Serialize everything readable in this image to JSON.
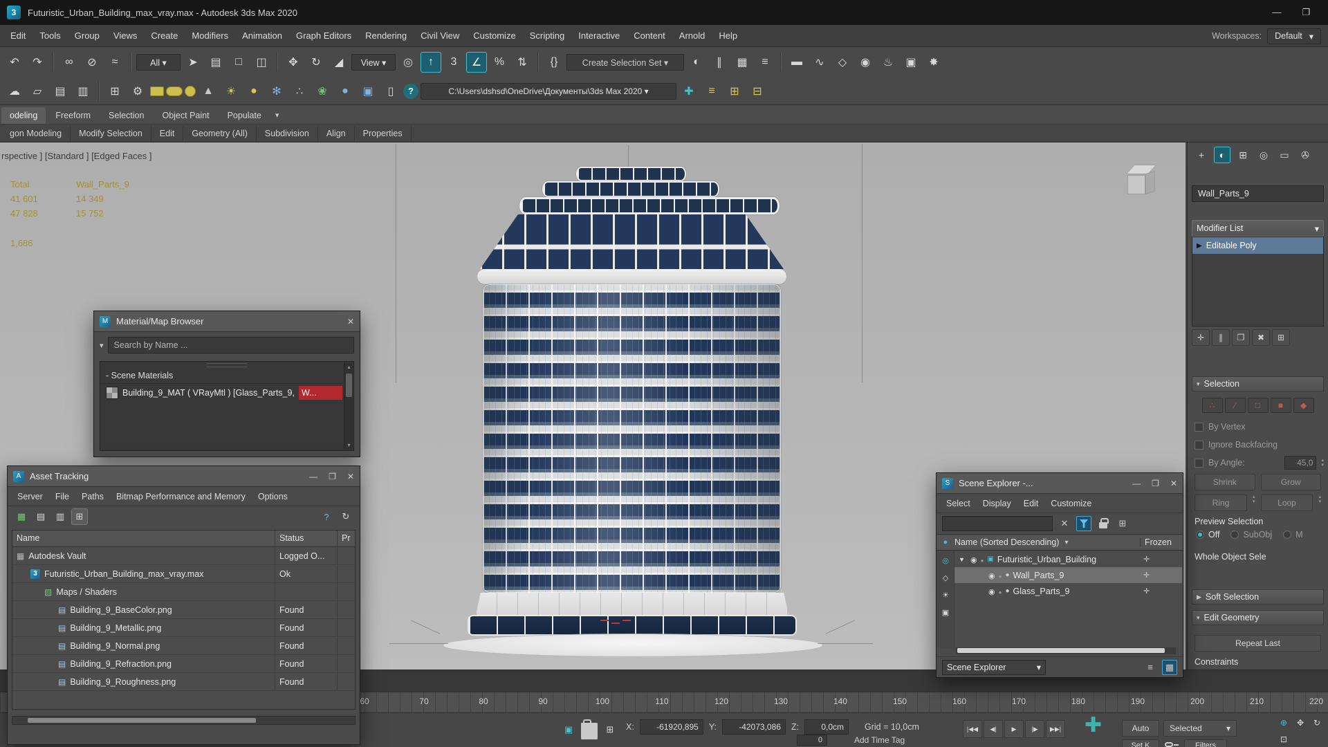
{
  "window": {
    "title": "Futuristic_Urban_Building_max_vray.max - Autodesk 3ds Max 2020",
    "logo_glyph": "3"
  },
  "icons": {
    "minimize": "—",
    "maximize": "❐",
    "close": "✕",
    "caret_down": "▾",
    "caret_right": "▶",
    "caret_up": "▴",
    "search_caret": "▾"
  },
  "menubar": {
    "items": [
      "Edit",
      "Tools",
      "Group",
      "Views",
      "Create",
      "Modifiers",
      "Animation",
      "Graph Editors",
      "Rendering",
      "Civil View",
      "Customize",
      "Scripting",
      "Interactive",
      "Content",
      "Arnold",
      "Help"
    ],
    "workspaces_label": "Workspaces:",
    "workspaces_value": "Default"
  },
  "toolbar1": {
    "items": [
      {
        "name": "undo-icon",
        "glyph": "↶",
        "inter": "true"
      },
      {
        "name": "redo-icon",
        "glyph": "↷",
        "inter": "true"
      },
      {
        "name": "divider",
        "cls": "tdiv",
        "glyph": "",
        "inter": "false"
      },
      {
        "name": "select-and-link-icon",
        "glyph": "∞",
        "inter": "true"
      },
      {
        "name": "unlink-selection-icon",
        "glyph": "⊘",
        "inter": "true"
      },
      {
        "name": "bind-to-space-warp-icon",
        "glyph": "≈",
        "inter": "true"
      },
      {
        "name": "divider",
        "cls": "tdiv",
        "glyph": "",
        "inter": "false"
      },
      {
        "name": "selection-filter-dropdown",
        "glyph": "All ▾",
        "cls": "dd",
        "inter": "true"
      },
      {
        "name": "select-object-icon",
        "glyph": "➤",
        "inter": "true"
      },
      {
        "name": "select-by-name-icon",
        "glyph": "▤",
        "inter": "true"
      },
      {
        "name": "rectangular-selection-region-icon",
        "glyph": "□",
        "inter": "true"
      },
      {
        "name": "window-crossing-toggle-icon",
        "glyph": "◫",
        "inter": "true"
      },
      {
        "name": "divider",
        "cls": "tdiv",
        "glyph": "",
        "inter": "false"
      },
      {
        "name": "select-and-move-icon",
        "glyph": "✥",
        "inter": "true"
      },
      {
        "name": "select-and-rotate-icon",
        "glyph": "↻",
        "inter": "true"
      },
      {
        "name": "select-and-scale-icon",
        "glyph": "◢",
        "inter": "true"
      },
      {
        "name": "reference-coordinate-dropdown",
        "glyph": "View ▾",
        "cls": "dd",
        "inter": "true"
      },
      {
        "name": "use-pivot-point-center-icon",
        "glyph": "◎",
        "inter": "true"
      },
      {
        "name": "select-and-place-icon",
        "glyph": "↑",
        "cls": "active",
        "inter": "true"
      },
      {
        "name": "snaps-toggle-icon",
        "glyph": "3",
        "inter": "true"
      },
      {
        "name": "angle-snap-toggle-icon",
        "glyph": "∠",
        "cls": "active",
        "inter": "true"
      },
      {
        "name": "percent-snap-toggle-icon",
        "glyph": "%",
        "inter": "true"
      },
      {
        "name": "spinner-snap-toggle-icon",
        "glyph": "⇅",
        "inter": "true"
      },
      {
        "name": "divider",
        "cls": "tdiv",
        "glyph": "",
        "inter": "false"
      },
      {
        "name": "edit-named-selection-sets-icon",
        "glyph": "{}",
        "inter": "true"
      },
      {
        "name": "named-selection-set-dropdown",
        "glyph": "Create Selection Set ▾",
        "cls": "dd ddwide",
        "inter": "true"
      },
      {
        "name": "mirror-icon",
        "glyph": "◐",
        "inter": "true"
      },
      {
        "name": "align-icon",
        "glyph": "∥",
        "inter": "true"
      },
      {
        "name": "toggle-scene-explorer-icon",
        "glyph": "▦",
        "inter": "true"
      },
      {
        "name": "toggle-layer-explorer-icon",
        "glyph": "≡",
        "inter": "true"
      },
      {
        "name": "divider",
        "cls": "tdiv",
        "glyph": "",
        "inter": "false"
      },
      {
        "name": "toggle-ribbon-icon",
        "glyph": "▬",
        "inter": "true"
      },
      {
        "name": "curve-editor-icon",
        "glyph": "∿",
        "inter": "true"
      },
      {
        "name": "schematic-view-icon",
        "glyph": "◇",
        "inter": "true"
      },
      {
        "name": "material-editor-icon",
        "glyph": "◉",
        "inter": "true"
      },
      {
        "name": "render-setup-icon",
        "glyph": "♨",
        "inter": "true"
      },
      {
        "name": "rendered-frame-window-icon",
        "glyph": "▣",
        "inter": "true"
      },
      {
        "name": "render-production-icon",
        "glyph": "✸",
        "inter": "true"
      }
    ]
  },
  "toolbar2": {
    "items": [
      {
        "name": "autoback-cloud-icon",
        "glyph": "☁",
        "inter": "true"
      },
      {
        "name": "new-scene-icon",
        "glyph": "▱",
        "inter": "true"
      },
      {
        "name": "open-file-icon",
        "glyph": "▤",
        "inter": "true"
      },
      {
        "name": "save-file-icon",
        "glyph": "▥",
        "inter": "true"
      },
      {
        "name": "divider",
        "cls": "tdiv",
        "glyph": "",
        "inter": "false"
      },
      {
        "name": "grid-helper-icon",
        "glyph": "⊞",
        "inter": "true"
      },
      {
        "name": "gear-icon",
        "glyph": "⚙",
        "inter": "true"
      },
      {
        "name": "swatch-square-icon",
        "glyph": "",
        "cls": "sw",
        "inter": "true"
      },
      {
        "name": "swatch-pill-icon",
        "glyph": "",
        "cls": "sw sw-pill",
        "inter": "true"
      },
      {
        "name": "swatch-circle-icon",
        "glyph": "",
        "cls": "sw sw-circle",
        "inter": "true"
      },
      {
        "name": "cone-primitive-icon",
        "glyph": "▲",
        "cls": "c-gray",
        "inter": "true"
      },
      {
        "name": "sunlight-icon",
        "glyph": "☀",
        "cls": "c-yellow",
        "inter": "true"
      },
      {
        "name": "sphere-primitive-icon",
        "glyph": "●",
        "cls": "c-yellow",
        "inter": "true"
      },
      {
        "name": "snowflake-icon",
        "glyph": "✻",
        "cls": "c-blue",
        "inter": "true"
      },
      {
        "name": "scatter-icon",
        "glyph": "∴",
        "cls": "c-gray",
        "inter": "true"
      },
      {
        "name": "foliage-icon",
        "glyph": "❀",
        "cls": "c-green",
        "inter": "true"
      },
      {
        "name": "physical-sphere-icon",
        "glyph": "●",
        "cls": "c-blue",
        "inter": "true"
      },
      {
        "name": "compositor-icon",
        "glyph": "▣",
        "cls": "c-blue",
        "inter": "true"
      },
      {
        "name": "state-sets-icon",
        "glyph": "▯",
        "inter": "true"
      },
      {
        "name": "help-icon",
        "glyph": "?",
        "cls": "help",
        "inter": "true"
      },
      {
        "name": "project-folder-dropdown",
        "glyph": "C:\\Users\\dshsd\\OneDrive\\Документы\\3ds Max 2020  ▾",
        "cls": "dd path",
        "inter": "true"
      },
      {
        "name": "create-new-folder-icon",
        "glyph": "✚",
        "cls": "c-teal",
        "inter": "true"
      },
      {
        "name": "layer-list-icon",
        "glyph": "≡",
        "cls": "c-yellow",
        "inter": "true"
      },
      {
        "name": "add-grid-icon",
        "glyph": "⊞",
        "cls": "c-yellow",
        "inter": "true"
      },
      {
        "name": "remove-grid-icon",
        "glyph": "⊟",
        "cls": "c-yellow",
        "inter": "true"
      }
    ]
  },
  "ribbon": {
    "tabs": [
      {
        "label": "odeling",
        "cls": "active",
        "inter": "true"
      },
      {
        "label": "Freeform",
        "inter": "true"
      },
      {
        "label": "Selection",
        "inter": "true"
      },
      {
        "label": "Object Paint",
        "inter": "true"
      },
      {
        "label": "Populate",
        "inter": "true"
      }
    ],
    "panels": [
      "gon Modeling",
      "Modify Selection",
      "Edit",
      "Geometry (All)",
      "Subdivision",
      "Align",
      "Properties"
    ]
  },
  "viewport": {
    "label": "rspective ] [Standard ] [Edged Faces ]",
    "stats": {
      "col1": "Total",
      "col2": "Wall_Parts_9",
      "r1c1": "41 601",
      "r1c2": "14 349",
      "r2c1": "47 828",
      "r2c2": "15 752",
      "extra": "1,686"
    }
  },
  "material_browser": {
    "title": "Material/Map Browser",
    "search_placeholder": "Search by Name ...",
    "section": "- Scene Materials",
    "material_main": "Building_9_MAT   ( VRayMtl )  [Glass_Parts_9, ",
    "material_tail": "W..."
  },
  "asset_tracking": {
    "title": "Asset Tracking",
    "menus": [
      "Server",
      "File",
      "Paths",
      "Bitmap Performance and Memory",
      "Options"
    ],
    "toolbar": [
      {
        "name": "table-view-icon",
        "glyph": "▦",
        "cls": "c-green",
        "inter": "true"
      },
      {
        "name": "list-view-icon",
        "glyph": "▤",
        "inter": "true"
      },
      {
        "name": "details-view-icon",
        "glyph": "▥",
        "inter": "true"
      },
      {
        "name": "grid-view-icon",
        "glyph": "⊞",
        "cls": "pressed",
        "inter": "true"
      },
      {
        "name": "spacer",
        "cls": "sp",
        "glyph": "",
        "inter": "false"
      },
      {
        "name": "help-icon",
        "glyph": "?",
        "cls": "c-blue",
        "inter": "true"
      },
      {
        "name": "refresh-icon",
        "glyph": "↻",
        "inter": "true"
      }
    ],
    "columns": {
      "name": "Name",
      "status": "Status",
      "progress": "Pr"
    },
    "rows": [
      {
        "label": "Autodesk Vault",
        "status": "Logged O...",
        "cls": "lvl0",
        "icon": "ic-vault",
        "iname": "vault-icon",
        "iglyph": "▦"
      },
      {
        "label": "Futuristic_Urban_Building_max_vray.max",
        "status": "Ok",
        "cls": "lvl1",
        "icon": "ic-max",
        "iname": "max-file-icon",
        "iglyph": "3"
      },
      {
        "label": "Maps / Shaders",
        "status": "",
        "cls": "lvl2",
        "icon": "ic-maps",
        "iname": "maps-folder-icon",
        "iglyph": "▧"
      },
      {
        "label": "Building_9_BaseColor.png",
        "status": "Found",
        "cls": "lvl3",
        "icon": "ic-bmp",
        "iname": "bitmap-file-icon",
        "iglyph": "▤"
      },
      {
        "label": "Building_9_Metallic.png",
        "status": "Found",
        "cls": "lvl3",
        "icon": "ic-bmp",
        "iname": "bitmap-file-icon",
        "iglyph": "▤"
      },
      {
        "label": "Building_9_Normal.png",
        "status": "Found",
        "cls": "lvl3",
        "icon": "ic-bmp",
        "iname": "bitmap-file-icon",
        "iglyph": "▤"
      },
      {
        "label": "Building_9_Refraction.png",
        "status": "Found",
        "cls": "lvl3",
        "icon": "ic-bmp",
        "iname": "bitmap-file-icon",
        "iglyph": "▤"
      },
      {
        "label": "Building_9_Roughness.png",
        "status": "Found",
        "cls": "lvl3",
        "icon": "ic-bmp",
        "iname": "bitmap-file-icon",
        "iglyph": "▤"
      }
    ]
  },
  "scene_explorer": {
    "title": "Scene Explorer -...",
    "menus": [
      "Select",
      "Display",
      "Edit",
      "Customize"
    ],
    "header_name": "Name (Sorted Descending)",
    "header_frozen": "Frozen",
    "footer_value": "Scene Explorer",
    "filters": [
      {
        "name": "display-geometry-icon",
        "glyph": "◎",
        "cls": "c-teal",
        "inter": "true"
      },
      {
        "name": "display-shapes-icon",
        "glyph": "◇",
        "inter": "true"
      },
      {
        "name": "display-lights-icon",
        "glyph": "☀",
        "inter": "true"
      },
      {
        "name": "display-cameras-icon",
        "glyph": "▣",
        "inter": "true"
      }
    ],
    "rows": [
      {
        "label": "Futuristic_Urban_Building",
        "cls": "lvl0",
        "caret": "▼",
        "iname": "group-icon",
        "iglyph": "▣",
        "icls": "c-teal"
      },
      {
        "label": "Wall_Parts_9",
        "cls": "lvl1 selected",
        "caret": "",
        "iname": "geometry-icon",
        "iglyph": "●",
        "icls": "c-gray2"
      },
      {
        "label": "Glass_Parts_9",
        "cls": "lvl1",
        "caret": "",
        "iname": "geometry-icon",
        "iglyph": "●",
        "icls": "c-gray2"
      }
    ]
  },
  "command_panel": {
    "tabs": [
      {
        "name": "create-tab-icon",
        "glyph": "+",
        "inter": "true"
      },
      {
        "name": "modify-tab-icon",
        "glyph": "◐",
        "cls": "active",
        "inter": "true"
      },
      {
        "name": "hierarchy-tab-icon",
        "glyph": "⊞",
        "inter": "true"
      },
      {
        "name": "motion-tab-icon",
        "glyph": "◎",
        "inter": "true"
      },
      {
        "name": "display-tab-icon",
        "glyph": "▭",
        "inter": "true"
      },
      {
        "name": "utilities-tab-icon",
        "glyph": "✇",
        "inter": "true"
      }
    ],
    "object_name": "Wall_Parts_9",
    "modifier_list_label": "Modifier List",
    "stack_item": "Editable Poly",
    "stack_tools": [
      {
        "name": "pin-stack-icon",
        "glyph": "✛",
        "inter": "true"
      },
      {
        "name": "show-end-result-icon",
        "glyph": "∥",
        "inter": "true"
      },
      {
        "name": "make-unique-icon",
        "glyph": "❐",
        "inter": "true"
      },
      {
        "name": "remove-modifier-icon",
        "glyph": "✖",
        "inter": "true"
      },
      {
        "name": "configure-modifier-sets-icon",
        "glyph": "⊞",
        "inter": "true"
      }
    ],
    "selection": {
      "title": "Selection",
      "subobject": [
        {
          "name": "vertex-subobject-icon",
          "glyph": "∴",
          "inter": "true"
        },
        {
          "name": "edge-subobject-icon",
          "glyph": "∕",
          "inter": "true"
        },
        {
          "name": "border-subobject-icon",
          "glyph": "□",
          "inter": "true"
        },
        {
          "name": "polygon-subobject-icon",
          "glyph": "■",
          "inter": "true"
        },
        {
          "name": "element-subobject-icon",
          "glyph": "◆",
          "inter": "true"
        }
      ],
      "by_vertex": "By Vertex",
      "ignore_backfacing": "Ignore Backfacing",
      "by_angle": "By Angle:",
      "by_angle_value": "45,0",
      "shrink": "Shrink",
      "grow": "Grow",
      "ring": "Ring",
      "loop": "Loop",
      "preview_title": "Preview Selection",
      "opt_off": "Off",
      "opt_subobj": "SubObj",
      "opt_multi": "M",
      "whole_object": "Whole Object Sele"
    },
    "soft_selection": "Soft Selection",
    "edit_geometry": "Edit Geometry",
    "repeat_last": "Repeat Last",
    "constraints": "Constraints"
  },
  "timeline": {
    "ticks": [
      "60",
      "70",
      "80",
      "90",
      "100",
      "110",
      "120",
      "130",
      "140",
      "150",
      "160",
      "170",
      "180",
      "190",
      "200",
      "210",
      "220"
    ]
  },
  "status_bar": {
    "left_icons": [
      {
        "name": "isolate-selection-icon",
        "glyph": "▣",
        "cls": "c-teal",
        "inter": "true"
      },
      {
        "name": "selection-lock-icon",
        "glyph": "",
        "cls": "lockcss",
        "inter": "true"
      },
      {
        "name": "absolute-mode-icon",
        "glyph": "⊞",
        "inter": "true"
      }
    ],
    "x_label": "X:",
    "x_value": "-61920,895",
    "y_label": "Y:",
    "y_value": "-42073,086",
    "z_label": "Z:",
    "z_value": "0,0cm",
    "grid_label": "Grid = 10,0cm",
    "add_time_tag": "Add Time Tag",
    "frame_value": "0",
    "playback": [
      {
        "name": "go-to-start-icon",
        "glyph": "|◀◀",
        "inter": "true"
      },
      {
        "name": "previous-frame-icon",
        "glyph": "◀|",
        "inter": "true"
      },
      {
        "name": "play-icon",
        "glyph": "▶",
        "inter": "true"
      },
      {
        "name": "next-frame-icon",
        "glyph": "|▶",
        "inter": "true"
      },
      {
        "name": "go-to-end-icon",
        "glyph": "▶▶|",
        "inter": "true"
      }
    ],
    "set_key_plus": "✚",
    "auto_label": "Auto",
    "selected_label": "Selected",
    "set_key_label": "Set K",
    "filters_label": "Filters",
    "nav_icons": [
      {
        "name": "zoom-icon",
        "glyph": "⊕",
        "cls": "c-teal",
        "inter": "true"
      },
      {
        "name": "pan-icon",
        "glyph": "✥",
        "inter": "true"
      },
      {
        "name": "orbit-icon",
        "glyph": "↻",
        "inter": "true"
      },
      {
        "name": "maximize-viewport-icon",
        "glyph": "⊡",
        "inter": "true"
      }
    ]
  }
}
